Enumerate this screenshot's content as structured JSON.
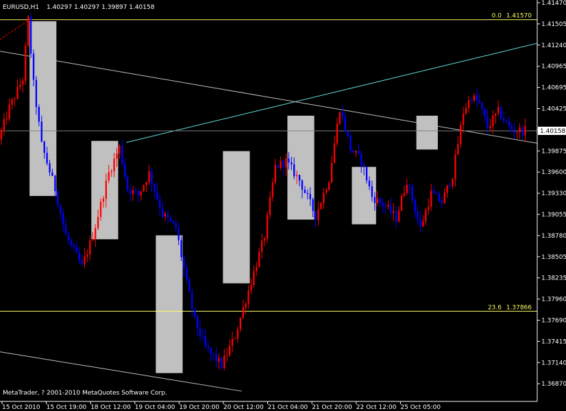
{
  "header": {
    "symbol": "EURUSD,H1",
    "ohlc": "1.40297 1.40297 1.39897 1.40158"
  },
  "copyright": "MetaTrader, ? 2001-2010 MetaQuotes Software Corp.",
  "colors": {
    "background": "#000000",
    "bull": "#ff0000",
    "bear": "#0000ff",
    "rect": "#c0c0c0",
    "fib": "#ffff66",
    "cyan": "#66e0e0",
    "white_line": "#c0c0c0",
    "ask_line": "#808080",
    "axis": "#ffffff"
  },
  "fib_levels": [
    {
      "level": "0.0",
      "price": 1.4157,
      "label": "1.41570"
    },
    {
      "level": "23.6",
      "price": 1.37866,
      "label": "1.37866"
    }
  ],
  "price_marker": "1.40158",
  "chart_data": {
    "type": "candlestick",
    "title": "EURUSD,H1",
    "ylim": [
      1.3672,
      1.4182
    ],
    "y_ticks": [
      "1.41470",
      "1.41505",
      "1.41240",
      "1.40965",
      "1.40695",
      "1.40425",
      "1.40158",
      "1.39875",
      "1.39600",
      "1.39330",
      "1.39055",
      "1.38780",
      "1.38505",
      "1.38235",
      "1.37960",
      "1.37690",
      "1.37415",
      "1.37140",
      "1.36870"
    ],
    "x_ticks": [
      "15 Oct 2010",
      "15 Oct 19:00",
      "18 Oct 12:00",
      "19 Oct 04:00",
      "19 Oct 20:00",
      "20 Oct 12:00",
      "21 Oct 04:00",
      "21 Oct 20:00",
      "22 Oct 12:00",
      "25 Oct 05:00"
    ],
    "x_range": [
      0,
      200
    ],
    "candle_count": 196,
    "swing_points": [
      [
        0,
        1.4005
      ],
      [
        4,
        1.4045
      ],
      [
        9,
        1.4082
      ],
      [
        11,
        1.4157
      ],
      [
        13,
        1.4075
      ],
      [
        16,
        1.3998
      ],
      [
        21,
        1.3942
      ],
      [
        25,
        1.3882
      ],
      [
        31,
        1.3843
      ],
      [
        35,
        1.3882
      ],
      [
        41,
        1.3962
      ],
      [
        45,
        1.3995
      ],
      [
        48,
        1.3942
      ],
      [
        52,
        1.3934
      ],
      [
        56,
        1.3962
      ],
      [
        61,
        1.391
      ],
      [
        66,
        1.3892
      ],
      [
        70,
        1.3822
      ],
      [
        73,
        1.3775
      ],
      [
        77,
        1.374
      ],
      [
        83,
        1.3718
      ],
      [
        88,
        1.3755
      ],
      [
        93,
        1.3813
      ],
      [
        99,
        1.3882
      ],
      [
        103,
        1.397
      ],
      [
        107,
        1.3977
      ],
      [
        112,
        1.3953
      ],
      [
        118,
        1.3908
      ],
      [
        123,
        1.3955
      ],
      [
        127,
        1.4045
      ],
      [
        131,
        1.3993
      ],
      [
        135,
        1.3978
      ],
      [
        139,
        1.3932
      ],
      [
        144,
        1.392
      ],
      [
        148,
        1.3905
      ],
      [
        152,
        1.3953
      ],
      [
        157,
        1.3892
      ],
      [
        161,
        1.3936
      ],
      [
        165,
        1.3925
      ],
      [
        169,
        1.396
      ],
      [
        173,
        1.404
      ],
      [
        176,
        1.406
      ],
      [
        179,
        1.405
      ],
      [
        182,
        1.402
      ],
      [
        186,
        1.404
      ],
      [
        191,
        1.4016
      ],
      [
        195,
        1.4016
      ]
    ],
    "rectangles": [
      {
        "x0": 11,
        "x1": 21,
        "price_top": 1.4155,
        "price_bottom": 1.3933
      },
      {
        "x0": 34,
        "x1": 44,
        "price_top": 1.4003,
        "price_bottom": 1.3878
      },
      {
        "x0": 58,
        "x1": 68,
        "price_top": 1.3883,
        "price_bottom": 1.3708
      },
      {
        "x0": 83,
        "x1": 93,
        "price_top": 1.399,
        "price_bottom": 1.3822
      },
      {
        "x0": 107,
        "x1": 117,
        "price_top": 1.4035,
        "price_bottom": 1.3903
      },
      {
        "x0": 131,
        "x1": 140,
        "price_top": 1.397,
        "price_bottom": 1.3897
      },
      {
        "x0": 155,
        "x1": 163,
        "price_top": 1.4035,
        "price_bottom": 1.3992
      }
    ],
    "trendlines": [
      {
        "color": "cyan",
        "x0": 47,
        "p0": 1.4001,
        "x1": 200,
        "p1": 1.4127
      },
      {
        "color": "white",
        "x0": 0,
        "p0": 1.4117,
        "x1": 200,
        "p1": 1.4
      },
      {
        "color": "white",
        "x0": 0,
        "p0": 1.3735,
        "x1": 90,
        "p1": 1.3685
      },
      {
        "color": "red_dash",
        "x0": 0,
        "p0": 1.4132,
        "x1": 11,
        "p1": 1.4157
      }
    ]
  }
}
